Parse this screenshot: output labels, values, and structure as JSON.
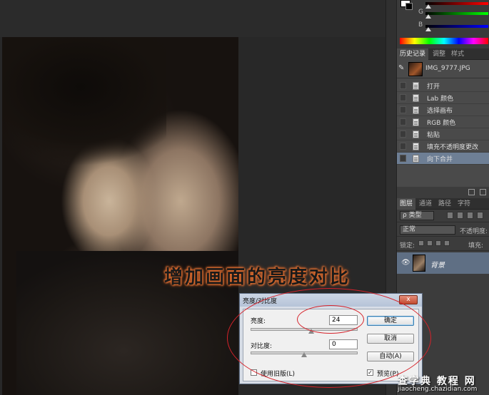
{
  "caption": "增加画面的亮度对比",
  "color_panel": {
    "labels": [
      "",
      "G",
      "B"
    ],
    "accent": "#e06a2a"
  },
  "history_panel": {
    "tabs": [
      "历史记录",
      "调整",
      "样式"
    ],
    "snapshot": "IMG_9777.JPG",
    "items": [
      "打开",
      "Lab 颜色",
      "选择画布",
      "RGB 颜色",
      "粘贴",
      "填充不透明度更改",
      "向下合并"
    ]
  },
  "layers_panel": {
    "tabs": [
      "图层",
      "通道",
      "路径",
      "字符"
    ],
    "filter_type": "ρ 类型",
    "blend_mode": "正常",
    "opacity_label": "不透明度:",
    "lock_label": "锁定:",
    "fill_label": "填充:",
    "layer_name": "背景"
  },
  "dialog": {
    "title": "亮度/对比度",
    "close_label": "x",
    "brightness_label": "亮度:",
    "brightness_value": "24",
    "contrast_label": "对比度:",
    "contrast_value": "0",
    "legacy_label": "使用旧版(L)",
    "legacy_checked": false,
    "ok_label": "确定",
    "cancel_label": "取消",
    "auto_label": "自动(A)",
    "preview_label": "预览(P)",
    "preview_checked": true
  },
  "watermark": {
    "line1": "查字典 教程 网",
    "line2": "jiaocheng.chazidian.com"
  }
}
